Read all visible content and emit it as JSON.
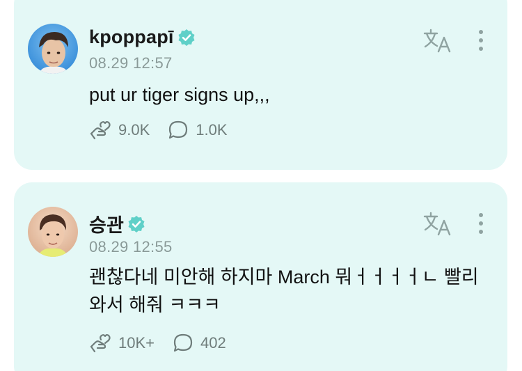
{
  "posts": [
    {
      "author": "kpoppapī",
      "verified": true,
      "timestamp": "08.29 12:57",
      "text": "put ur tiger signs up,,,",
      "likes": "9.0K",
      "comments": "1.0K"
    },
    {
      "author": "승관",
      "verified": true,
      "timestamp": "08.29 12:55",
      "text": "괜찮다네 미안해 하지마 March 뭐ㅓㅓㅓㅓㄴ 빨리 와서 해줘 ㅋㅋㅋ",
      "likes": "10K+",
      "comments": "402"
    }
  ],
  "colors": {
    "card_bg": "#e4f8f6",
    "verified": "#5fd0c8",
    "icon": "#6f7d7b"
  },
  "icons": {
    "translate": "translate-icon",
    "more": "more-vertical-icon",
    "like": "hand-heart-icon",
    "comment": "comment-bubble-icon",
    "verified": "verified-badge-icon"
  }
}
